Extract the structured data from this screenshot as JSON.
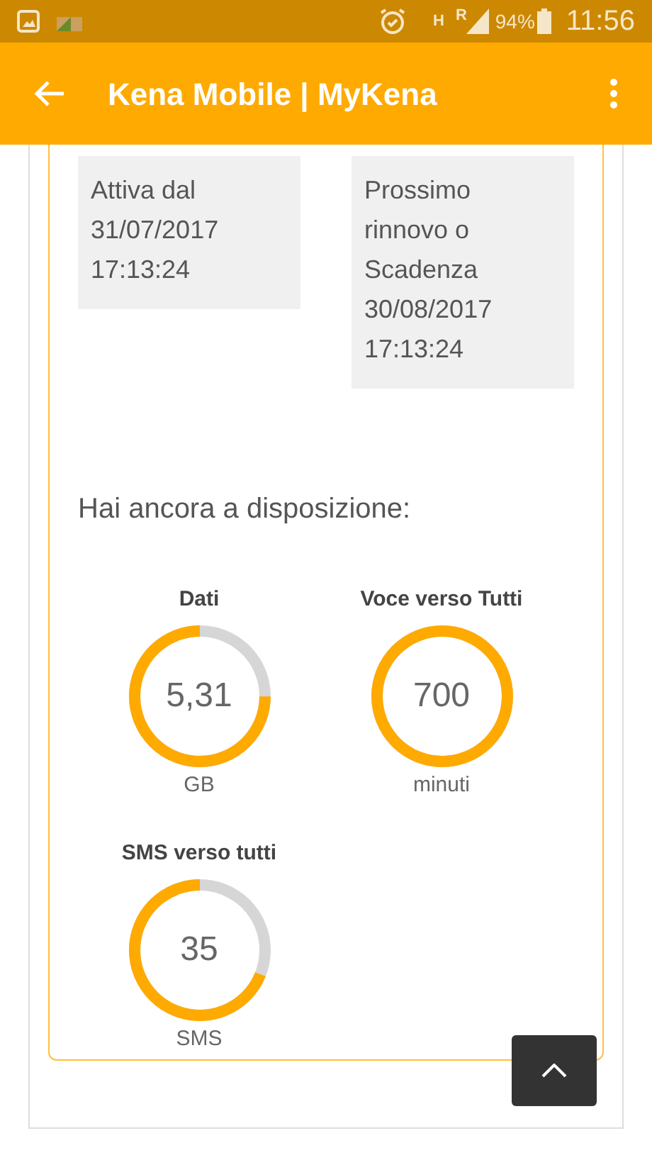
{
  "status_bar": {
    "network_h": "H",
    "network_r": "R",
    "battery": "94%",
    "time": "11:56"
  },
  "app_bar": {
    "title": "Kena Mobile | MyKena"
  },
  "dates": [
    {
      "text": "Attiva dal\n31/07/2017\n17:13:24"
    },
    {
      "text": "Prossimo\nrinnovo o\nScadenza\n30/08/2017\n17:13:24"
    }
  ],
  "heading": "Hai ancora a disposizione:",
  "gauges": [
    {
      "title": "Dati",
      "value": "5,31",
      "unit": "GB",
      "level": 0.75
    },
    {
      "title": "Voce verso Tutti",
      "value": "700",
      "unit": "minuti",
      "level": 1
    },
    {
      "title": "SMS verso tutti",
      "value": "35",
      "unit": "SMS",
      "level": 0.69
    }
  ]
}
